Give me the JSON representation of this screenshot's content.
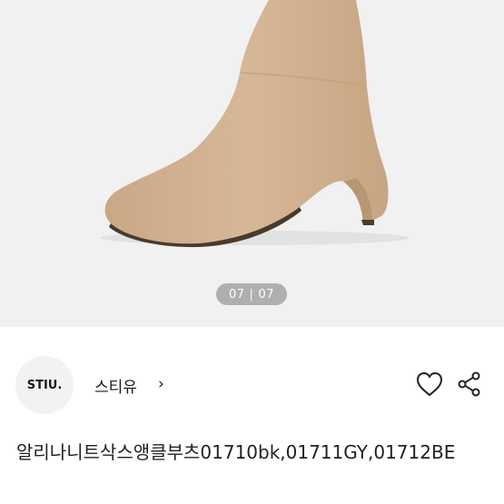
{
  "gallery": {
    "current": "07",
    "total": "07",
    "separator": "|"
  },
  "shop": {
    "logo_text": "STIU.",
    "name": "스티유",
    "chevron": "›"
  },
  "product": {
    "title": "알리나니트삭스앵클부츠01710bk,01711GY,01712BE"
  },
  "colors": {
    "boot": "#d1b191",
    "gallery_bg": "#f1f1f1"
  },
  "icons": {
    "favorite": "heart-icon",
    "share": "share-icon",
    "chevron": "chevron-right-icon"
  }
}
